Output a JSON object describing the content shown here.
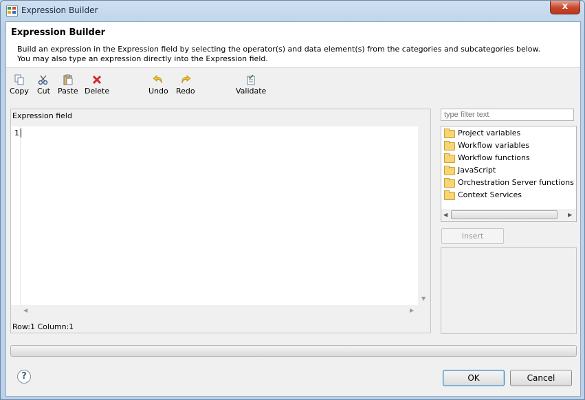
{
  "window": {
    "title": "Expression Builder",
    "close_label": "x"
  },
  "header": {
    "title": "Expression Builder",
    "description_line1": "Build an expression in the Expression field by selecting the operator(s) and data element(s) from the categories and subcategories below.",
    "description_line2": "You may also type an expression directly into the Expression field."
  },
  "toolbar": {
    "copy": "Copy",
    "cut": "Cut",
    "paste": "Paste",
    "delete": "Delete",
    "undo": "Undo",
    "redo": "Redo",
    "validate": "Validate"
  },
  "editor": {
    "label": "Expression field",
    "line_number": "1",
    "status": "Row:1 Column:1"
  },
  "filter": {
    "placeholder": "type filter text"
  },
  "tree": {
    "items": [
      "Project variables",
      "Workflow variables",
      "Workflow functions",
      "JavaScript",
      "Orchestration Server functions",
      "Context Services"
    ]
  },
  "buttons": {
    "insert": "Insert",
    "ok": "OK",
    "cancel": "Cancel"
  },
  "help": {
    "glyph": "?"
  },
  "colors": {
    "window_frame": "#bfd4ea",
    "close_button": "#c9452b",
    "folder": "#f7d574"
  }
}
